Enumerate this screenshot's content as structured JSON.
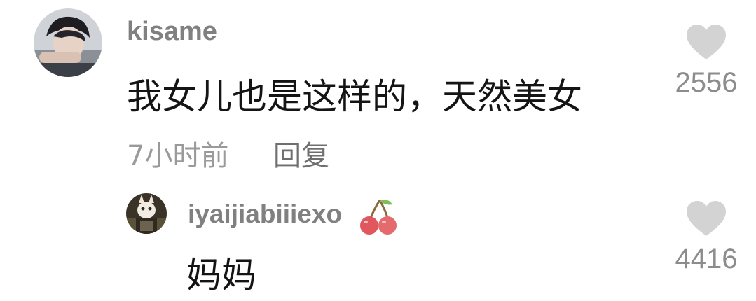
{
  "comment": {
    "username": "kisame",
    "text": "我女儿也是这样的，天然美女",
    "time": "7小时前",
    "reply_label": "回复",
    "likes": "2556",
    "avatar_icon": "user-avatar"
  },
  "reply": {
    "username": "iyaijiabiiiexo",
    "badge_icon": "cherry-emoji",
    "text": "妈妈",
    "likes": "4416",
    "avatar_icon": "user-avatar"
  },
  "colors": {
    "username": "#808080",
    "text": "#141414",
    "meta": "#9a9a9a",
    "heart": "#d3d3d3",
    "cherry": "#e0585d"
  }
}
